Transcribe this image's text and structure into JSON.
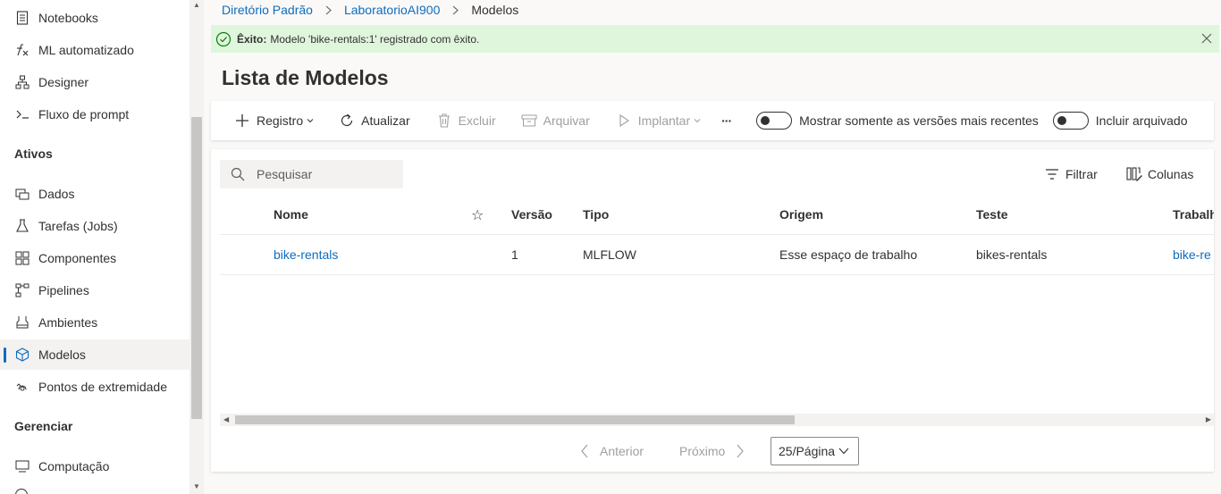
{
  "sidebar": {
    "items_top": [
      {
        "label": "Notebooks",
        "icon": "notebook-icon"
      },
      {
        "label": "ML automatizado",
        "icon": "automl-icon"
      },
      {
        "label": "Designer",
        "icon": "designer-icon"
      },
      {
        "label": "Fluxo de prompt",
        "icon": "prompt-flow-icon"
      }
    ],
    "assets_heading": "Ativos",
    "assets": [
      {
        "label": "Dados",
        "icon": "data-icon"
      },
      {
        "label": "Tarefas (Jobs)",
        "icon": "jobs-icon"
      },
      {
        "label": "Componentes",
        "icon": "components-icon"
      },
      {
        "label": "Pipelines",
        "icon": "pipelines-icon"
      },
      {
        "label": "Ambientes",
        "icon": "environments-icon"
      },
      {
        "label": "Modelos",
        "icon": "models-icon",
        "active": true
      },
      {
        "label": "Pontos de extremidade",
        "icon": "endpoints-icon"
      }
    ],
    "manage_heading": "Gerenciar",
    "manage": [
      {
        "label": "Computação",
        "icon": "compute-icon"
      }
    ]
  },
  "breadcrumb": {
    "items": [
      "Diretório Padrão",
      "LaboratorioAI900"
    ],
    "current": "Modelos"
  },
  "banner": {
    "status": "success",
    "bold": "Êxito:",
    "message": "Modelo 'bike-rentals:1' registrado com êxito."
  },
  "page_title": "Lista de Modelos",
  "toolbar": {
    "register": "Registro",
    "refresh": "Atualizar",
    "delete": "Excluir",
    "archive": "Arquivar",
    "deploy": "Implantar",
    "more": "···",
    "toggle_latest": "Mostrar somente as versões mais recentes",
    "toggle_archived": "Incluir arquivado"
  },
  "list": {
    "search_placeholder": "Pesquisar",
    "filter": "Filtrar",
    "columns": "Colunas",
    "headers": {
      "name": "Nome",
      "version": "Versão",
      "type": "Tipo",
      "origin": "Origem",
      "experiment": "Teste",
      "job": "Trabalh"
    },
    "rows": [
      {
        "name": "bike-rentals",
        "version": "1",
        "type": "MLFLOW",
        "origin": "Esse espaço de trabalho",
        "experiment": "bikes-rentals",
        "job": "bike-re"
      }
    ]
  },
  "pagination": {
    "prev": "Anterior",
    "next": "Próximo",
    "page_size": "25/Página"
  },
  "colors": {
    "accent": "#0f6cbd",
    "success_bg": "#dff6dd",
    "success_icon": "#107c10"
  }
}
